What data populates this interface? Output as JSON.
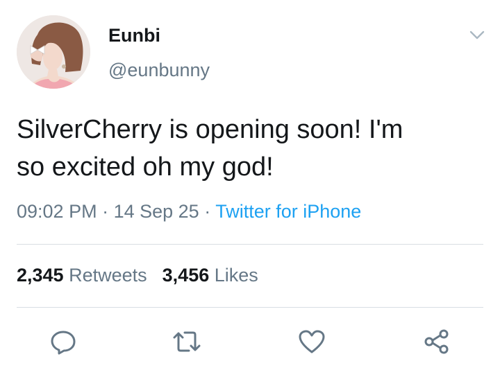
{
  "user": {
    "display_name": "Eunbi",
    "handle": "@eunbunny"
  },
  "tweet": {
    "text": "SilverCherry is opening soon! I'm\nso excited oh my god!",
    "time": "09:02 PM",
    "date": "14 Sep 25",
    "separator": " · ",
    "source": "Twitter for iPhone"
  },
  "stats": {
    "retweets_count": "2,345",
    "retweets_label": "Retweets",
    "likes_count": "3,456",
    "likes_label": "Likes"
  },
  "icons": {
    "menu": "chevron-down-icon",
    "reply": "reply-icon",
    "retweet": "retweet-icon",
    "like": "heart-icon",
    "share": "share-icon"
  },
  "colors": {
    "text_primary": "#14171a",
    "text_secondary": "#657786",
    "link": "#1da1f2",
    "divider": "#d8dee3"
  }
}
